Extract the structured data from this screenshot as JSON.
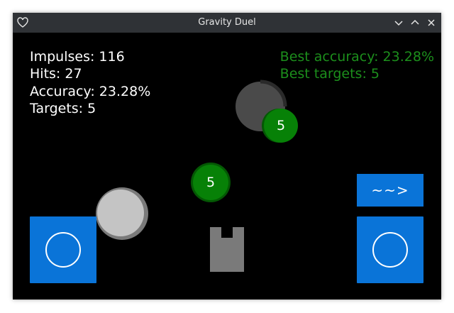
{
  "window": {
    "title": "Gravity Duel"
  },
  "titlebar_icons": {
    "app": "heart-icon",
    "minimize": "chevron-down-icon",
    "maximize": "chevron-up-icon",
    "close": "close-icon"
  },
  "stats": {
    "impulses": "Impulses: 116",
    "hits": "Hits: 27",
    "accuracy": "Accuracy: 23.28%",
    "targets": "Targets: 5"
  },
  "best": {
    "accuracy": "Best accuracy: 23.28%",
    "targets": "Best targets: 5"
  },
  "targets": [
    {
      "value": "5"
    },
    {
      "value": "5"
    }
  ],
  "controls": {
    "launch_label": "~~>",
    "left_button_icon": "circle-icon",
    "right_button_icon": "circle-icon"
  },
  "colors": {
    "background": "#000000",
    "titlebar": "#2f3236",
    "button": "#0a74d8",
    "target": "#078107",
    "best_text": "#1c8f1c"
  }
}
